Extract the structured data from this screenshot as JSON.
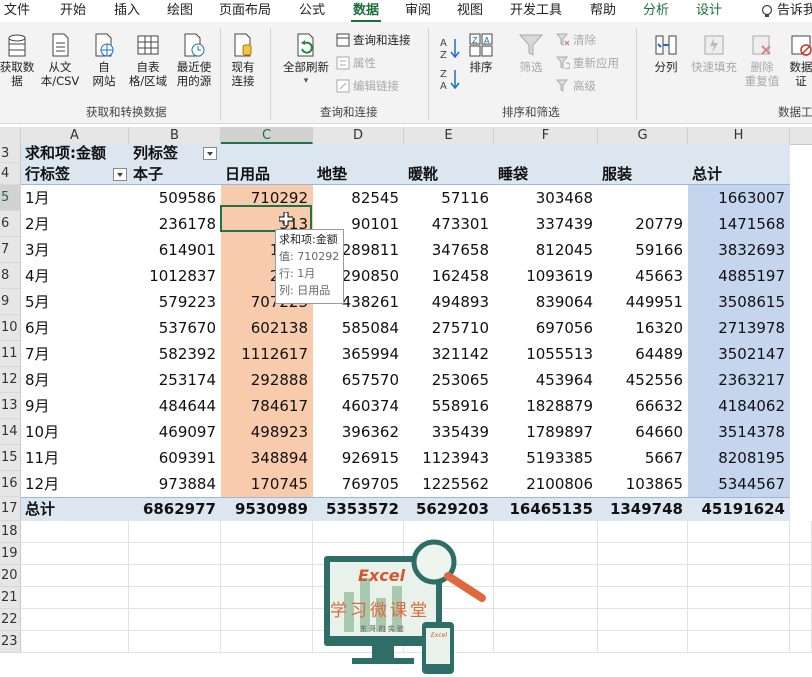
{
  "ribbon_tabs": [
    "文件",
    "开始",
    "插入",
    "绘图",
    "页面布局",
    "公式",
    "数据",
    "审阅",
    "视图",
    "开发工具",
    "帮助",
    "分析",
    "设计",
    "告诉我"
  ],
  "active_tab": "数据",
  "ribbon": {
    "get_data": "获取数\n据",
    "from_csv": "从文\n本/CSV",
    "from_web": "自\n网站",
    "from_table": "自表\n格/区域",
    "recent_sources": "最近使\n用的源",
    "existing_conn": "现有\n连接",
    "group_get": "获取和转换数据",
    "refresh_all": "全部刷新",
    "queries_conn": "查询和连接",
    "properties": "属性",
    "edit_links": "编辑链接",
    "group_query": "查询和连接",
    "sort": "排序",
    "filter": "筛选",
    "clear": "清除",
    "reapply": "重新应用",
    "advanced": "高级",
    "group_sort": "排序和筛选",
    "split": "分列",
    "flash_fill": "快速填充",
    "remove_dup": "删除\n重复值",
    "validate": "数据\n证",
    "group_tools": "数据工"
  },
  "columns": [
    "A",
    "B",
    "C",
    "D",
    "E",
    "F",
    "G",
    "H"
  ],
  "rows": [
    "3",
    "4",
    "5",
    "6",
    "7",
    "8",
    "9",
    "10",
    "11",
    "12",
    "13",
    "14",
    "15",
    "16",
    "17",
    "18",
    "19",
    "20",
    "21",
    "22",
    "23"
  ],
  "pivot": {
    "title": "求和项:金额",
    "col_label": "列标签",
    "row_label": "行标签",
    "headers": [
      "本子",
      "日用品",
      "地垫",
      "暖靴",
      "睡袋",
      "服装",
      "总计"
    ],
    "data": [
      [
        "1月",
        "509586",
        "710292",
        "82545",
        "57116",
        "303468",
        "",
        "1663007"
      ],
      [
        "2月",
        "236178",
        "313",
        "90101",
        "473301",
        "337439",
        "20779",
        "1471568"
      ],
      [
        "3月",
        "614901",
        "1709",
        "289811",
        "347658",
        "812045",
        "59166",
        "3832693"
      ],
      [
        "4月",
        "1012837",
        "2279",
        "290850",
        "162458",
        "1093619",
        "45663",
        "4885197"
      ],
      [
        "5月",
        "579223",
        "707223",
        "438261",
        "494893",
        "839064",
        "449951",
        "3508615"
      ],
      [
        "6月",
        "537670",
        "602138",
        "585084",
        "275710",
        "697056",
        "16320",
        "2713978"
      ],
      [
        "7月",
        "582392",
        "1112617",
        "365994",
        "321142",
        "1055513",
        "64489",
        "3502147"
      ],
      [
        "8月",
        "253174",
        "292888",
        "657570",
        "253065",
        "453964",
        "452556",
        "2363217"
      ],
      [
        "9月",
        "484644",
        "784617",
        "460374",
        "558916",
        "1828879",
        "66632",
        "4184062"
      ],
      [
        "10月",
        "469097",
        "498923",
        "396362",
        "335439",
        "1789897",
        "64660",
        "3514378"
      ],
      [
        "11月",
        "609391",
        "348894",
        "926915",
        "1123943",
        "5193385",
        "5667",
        "8208195"
      ],
      [
        "12月",
        "973884",
        "170745",
        "769705",
        "1225562",
        "2100806",
        "103865",
        "5344567"
      ]
    ],
    "total": [
      "总计",
      "6862977",
      "9530989",
      "5353572",
      "5629203",
      "16465135",
      "1349748",
      "45191624"
    ]
  },
  "tooltip": {
    "line1": "求和项:金额",
    "line2": "值: 710292",
    "line3": "行: 1月",
    "line4": "列: 日用品"
  },
  "logo": {
    "text1": "Excel",
    "text2": "学习微课堂",
    "text3": "东 哥 的 实 验",
    "small": "Excel"
  },
  "colors": {
    "accent": "#217346",
    "pivot_header": "#dce6f1",
    "col_c": "#f8cbad",
    "col_h": "#c5d5ee"
  }
}
